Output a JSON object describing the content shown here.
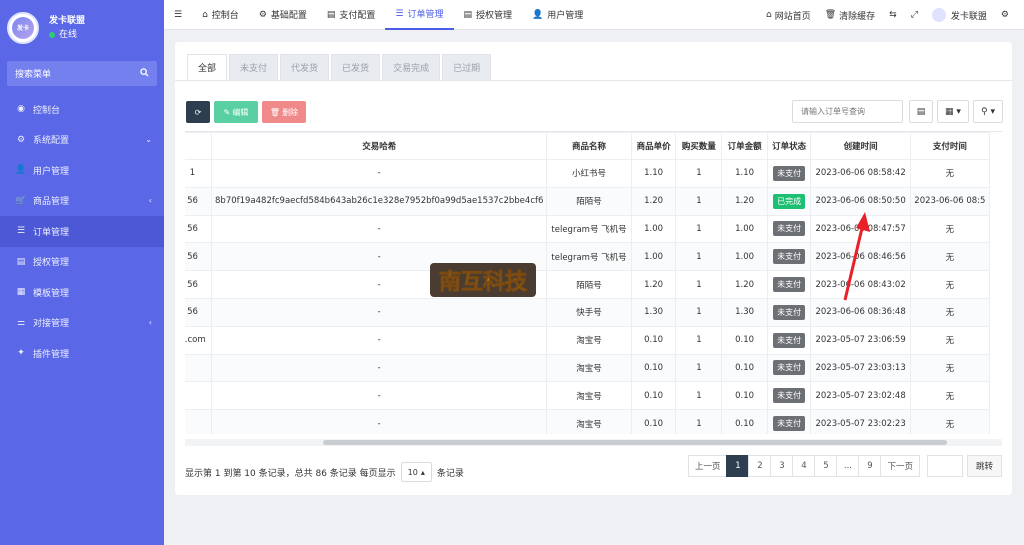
{
  "sidebar": {
    "app_name": "发卡联盟",
    "logo_text": "发卡",
    "status": "在线",
    "search_label": "搜索菜单",
    "items": [
      {
        "label": "控制台",
        "icon": "dashboard-icon",
        "caret": ""
      },
      {
        "label": "系统配置",
        "icon": "gear-icon",
        "caret": "⌄"
      },
      {
        "label": "用户管理",
        "icon": "user-icon",
        "caret": ""
      },
      {
        "label": "商品管理",
        "icon": "cart-icon",
        "caret": "‹"
      },
      {
        "label": "订单管理",
        "icon": "list-icon",
        "caret": ""
      },
      {
        "label": "授权管理",
        "icon": "doc-icon",
        "caret": ""
      },
      {
        "label": "模板管理",
        "icon": "template-icon",
        "caret": ""
      },
      {
        "label": "对接管理",
        "icon": "sliders-icon",
        "caret": "‹"
      },
      {
        "label": "插件管理",
        "icon": "plug-icon",
        "caret": ""
      }
    ]
  },
  "topbar": {
    "tabs": [
      {
        "label": "控制台"
      },
      {
        "label": "基础配置"
      },
      {
        "label": "支付配置"
      },
      {
        "label": "订单管理"
      },
      {
        "label": "授权管理"
      },
      {
        "label": "用户管理"
      }
    ],
    "site_home": "网站首页",
    "clear_cache": "清除缓存",
    "user_name": "发卡联盟"
  },
  "status_tabs": [
    "全部",
    "未支付",
    "代发货",
    "已发货",
    "交易完成",
    "已过期"
  ],
  "toolbar": {
    "edit_label": "编辑",
    "delete_label": "删除",
    "search_placeholder": "请输入订单号查询"
  },
  "table": {
    "headers": [
      "",
      "交易哈希",
      "商品名称",
      "商品单价",
      "购买数量",
      "订单金额",
      "订单状态",
      "创建时间",
      "支付时间"
    ],
    "rows": [
      {
        "c0": "1",
        "hash": "-",
        "name": "小红书号",
        "price": "1.10",
        "qty": "1",
        "amount": "1.10",
        "status": "未支付",
        "done": false,
        "created": "2023-06-06 08:58:42",
        "paid": "无"
      },
      {
        "c0": "56",
        "hash": "8b70f19a482fc9aecfd584b643ab26c1e328e7952bf0a99d5ae1537c2bbe4cf6",
        "name": "陌陌号",
        "price": "1.20",
        "qty": "1",
        "amount": "1.20",
        "status": "已完成",
        "done": true,
        "created": "2023-06-06 08:50:50",
        "paid": "2023-06-06 08:5"
      },
      {
        "c0": "56",
        "hash": "-",
        "name": "telegram号 飞机号",
        "price": "1.00",
        "qty": "1",
        "amount": "1.00",
        "status": "未支付",
        "done": false,
        "created": "2023-06-06 08:47:57",
        "paid": "无"
      },
      {
        "c0": "56",
        "hash": "-",
        "name": "telegram号 飞机号",
        "price": "1.00",
        "qty": "1",
        "amount": "1.00",
        "status": "未支付",
        "done": false,
        "created": "2023-06-06 08:46:56",
        "paid": "无"
      },
      {
        "c0": "56",
        "hash": "-",
        "name": "陌陌号",
        "price": "1.20",
        "qty": "1",
        "amount": "1.20",
        "status": "未支付",
        "done": false,
        "created": "2023-06-06 08:43:02",
        "paid": "无"
      },
      {
        "c0": "56",
        "hash": "-",
        "name": "快手号",
        "price": "1.30",
        "qty": "1",
        "amount": "1.30",
        "status": "未支付",
        "done": false,
        "created": "2023-06-06 08:36:48",
        "paid": "无"
      },
      {
        "c0": "q.com",
        "hash": "-",
        "name": "淘宝号",
        "price": "0.10",
        "qty": "1",
        "amount": "0.10",
        "status": "未支付",
        "done": false,
        "created": "2023-05-07 23:06:59",
        "paid": "无"
      },
      {
        "c0": "",
        "hash": "-",
        "name": "淘宝号",
        "price": "0.10",
        "qty": "1",
        "amount": "0.10",
        "status": "未支付",
        "done": false,
        "created": "2023-05-07 23:03:13",
        "paid": "无"
      },
      {
        "c0": "",
        "hash": "-",
        "name": "淘宝号",
        "price": "0.10",
        "qty": "1",
        "amount": "0.10",
        "status": "未支付",
        "done": false,
        "created": "2023-05-07 23:02:48",
        "paid": "无"
      },
      {
        "c0": "",
        "hash": "-",
        "name": "淘宝号",
        "price": "0.10",
        "qty": "1",
        "amount": "0.10",
        "status": "未支付",
        "done": false,
        "created": "2023-05-07 23:02:23",
        "paid": "无"
      }
    ]
  },
  "pagination": {
    "info_prefix": "显示第 1 到第 10 条记录，总共 86 条记录 每页显示",
    "page_size": "10",
    "info_suffix": "条记录",
    "prev": "上一页",
    "pages": [
      "1",
      "2",
      "3",
      "4",
      "5",
      "...",
      "9"
    ],
    "next": "下一页",
    "jump": "跳转"
  },
  "watermark_text": "南互科技",
  "colors": {
    "sidebar": "#5a67e6",
    "accent": "#4a5de8",
    "done": "#1dbf73",
    "unpaid": "#6c6f73",
    "arrow": "#e8202a"
  }
}
